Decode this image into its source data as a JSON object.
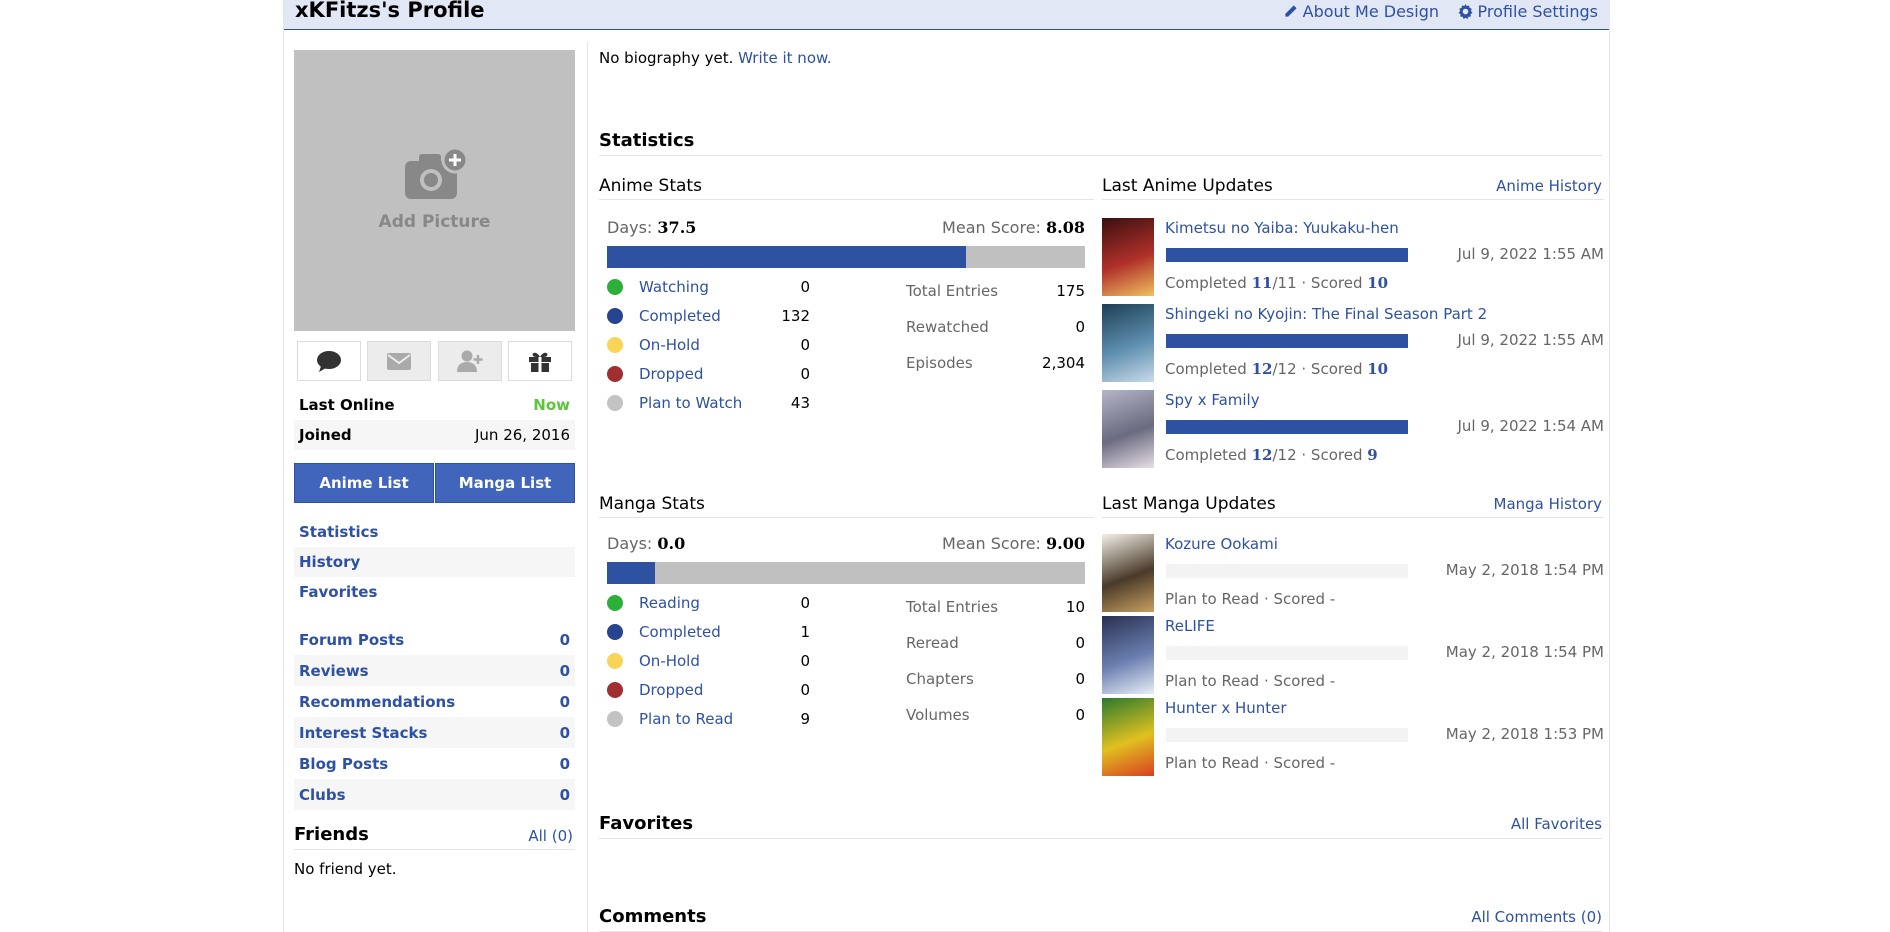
{
  "header": {
    "title": "xKFitzs's Profile",
    "about_me_design": "About Me Design",
    "profile_settings": "Profile Settings"
  },
  "picture": {
    "add_label": "Add Picture"
  },
  "user_info": {
    "last_online_label": "Last Online",
    "last_online_value": "Now",
    "joined_label": "Joined",
    "joined_value": "Jun 26, 2016"
  },
  "buttons": {
    "anime_list": "Anime List",
    "manga_list": "Manga List"
  },
  "nav": [
    "Statistics",
    "History",
    "Favorites"
  ],
  "counts": [
    {
      "label": "Forum Posts",
      "value": "0"
    },
    {
      "label": "Reviews",
      "value": "0"
    },
    {
      "label": "Recommendations",
      "value": "0"
    },
    {
      "label": "Interest Stacks",
      "value": "0"
    },
    {
      "label": "Blog Posts",
      "value": "0"
    },
    {
      "label": "Clubs",
      "value": "0"
    }
  ],
  "friends": {
    "title": "Friends",
    "all_link": "All (0)",
    "empty": "No friend yet."
  },
  "bio": {
    "text": "No biography yet.",
    "link": "Write it now."
  },
  "statistics": {
    "title": "Statistics"
  },
  "anime_stats": {
    "title": "Anime Stats",
    "days_label": "Days:",
    "days": "37.5",
    "mean_label": "Mean Score:",
    "mean": "8.08",
    "completed_fraction": 0.75,
    "rows": [
      {
        "label": "Watching",
        "value": "0",
        "color": "#2db039"
      },
      {
        "label": "Completed",
        "value": "132",
        "color": "#26448f"
      },
      {
        "label": "On-Hold",
        "value": "0",
        "color": "#f9d457"
      },
      {
        "label": "Dropped",
        "value": "0",
        "color": "#a12f31"
      },
      {
        "label": "Plan to Watch",
        "value": "43",
        "color": "#c3c3c3"
      }
    ],
    "totals": [
      {
        "label": "Total Entries",
        "value": "175"
      },
      {
        "label": "Rewatched",
        "value": "0"
      },
      {
        "label": "Episodes",
        "value": "2,304"
      }
    ]
  },
  "manga_stats": {
    "title": "Manga Stats",
    "days_label": "Days:",
    "days": "0.0",
    "mean_label": "Mean Score:",
    "mean": "9.00",
    "completed_fraction": 0.1,
    "rows": [
      {
        "label": "Reading",
        "value": "0",
        "color": "#2db039"
      },
      {
        "label": "Completed",
        "value": "1",
        "color": "#26448f"
      },
      {
        "label": "On-Hold",
        "value": "0",
        "color": "#f9d457"
      },
      {
        "label": "Dropped",
        "value": "0",
        "color": "#a12f31"
      },
      {
        "label": "Plan to Read",
        "value": "9",
        "color": "#c3c3c3"
      }
    ],
    "totals": [
      {
        "label": "Total Entries",
        "value": "10"
      },
      {
        "label": "Reread",
        "value": "0"
      },
      {
        "label": "Chapters",
        "value": "0"
      },
      {
        "label": "Volumes",
        "value": "0"
      }
    ]
  },
  "anime_updates": {
    "title": "Last Anime Updates",
    "history_link": "Anime History",
    "items": [
      {
        "title": "Kimetsu no Yaiba: Yuukaku-hen",
        "date": "Jul 9, 2022 1:55 AM",
        "status": "Completed",
        "progress": "11",
        "total": "/11",
        "scored_label": "· Scored",
        "score": "10",
        "fraction": 1
      },
      {
        "title": "Shingeki no Kyojin: The Final Season Part 2",
        "date": "Jul 9, 2022 1:55 AM",
        "status": "Completed",
        "progress": "12",
        "total": "/12",
        "scored_label": "· Scored",
        "score": "10",
        "fraction": 1
      },
      {
        "title": "Spy x Family",
        "date": "Jul 9, 2022 1:54 AM",
        "status": "Completed",
        "progress": "12",
        "total": "/12",
        "scored_label": "· Scored",
        "score": "9",
        "fraction": 1
      }
    ]
  },
  "manga_updates": {
    "title": "Last Manga Updates",
    "history_link": "Manga History",
    "items": [
      {
        "title": "Kozure Ookami",
        "date": "May 2, 2018 1:54 PM",
        "status": "Plan to Read · Scored -",
        "fraction": 0
      },
      {
        "title": "ReLIFE",
        "date": "May 2, 2018 1:54 PM",
        "status": "Plan to Read · Scored -",
        "fraction": 0
      },
      {
        "title": "Hunter x Hunter",
        "date": "May 2, 2018 1:53 PM",
        "status": "Plan to Read · Scored -",
        "fraction": 0
      }
    ]
  },
  "favorites": {
    "title": "Favorites",
    "all_link": "All Favorites"
  },
  "comments": {
    "title": "Comments",
    "all_link": "All Comments (0)"
  },
  "icons": {
    "about_me_design": "pencil-icon",
    "profile_settings": "gear-icon",
    "add_picture": "camera-plus-icon",
    "actions": [
      "comment-icon",
      "mail-icon",
      "add-friend-icon",
      "gift-icon"
    ]
  },
  "colors": {
    "brand": "#2e51a2",
    "online": "#5bc53b",
    "header_bg": "#e1e7f5"
  }
}
